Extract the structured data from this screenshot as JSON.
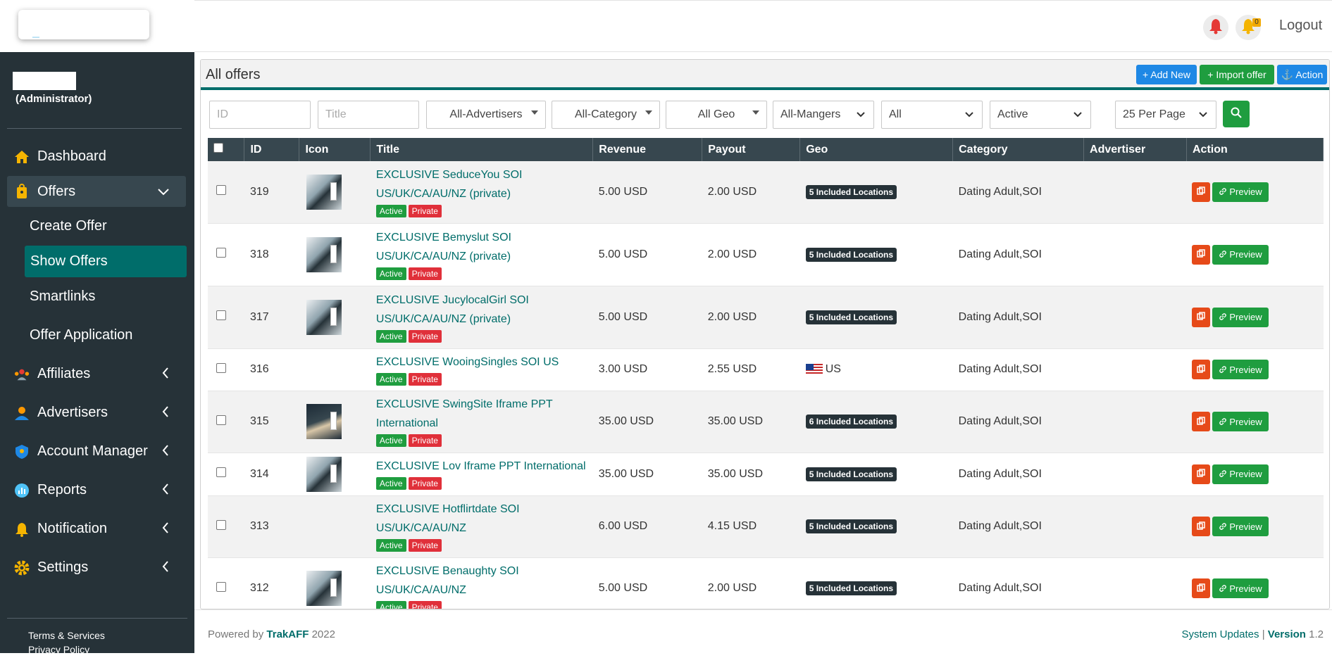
{
  "sidebar": {
    "user_role": "(Administrator)",
    "nav": {
      "dashboard": "Dashboard",
      "offers": "Offers",
      "create_offer": "Create Offer",
      "show_offers": "Show Offers",
      "smartlinks": "Smartlinks",
      "offer_application": "Offer Application",
      "affiliates": "Affiliates",
      "advertisers": "Advertisers",
      "account_manager": "Account Manager",
      "reports": "Reports",
      "notification": "Notification",
      "settings": "Settings"
    },
    "footer": {
      "terms": "Terms & Services",
      "privacy": "Privacy Policy"
    }
  },
  "topbar": {
    "notification_count": "0",
    "logout": "Logout"
  },
  "panel": {
    "title": "All offers",
    "add_new": "+ Add New",
    "import_offer": "+ Import offer",
    "action": "⚓ Action"
  },
  "filters": {
    "id_placeholder": "ID",
    "title_placeholder": "Title",
    "advertisers": "All-Advertisers",
    "category": "All-Category",
    "geo": "All Geo",
    "managers": "All-Mangers",
    "type": "All",
    "status": "Active",
    "per_page": "25 Per Page"
  },
  "table": {
    "headers": [
      "ID",
      "Icon",
      "Title",
      "Revenue",
      "Payout",
      "Geo",
      "Category",
      "Advertiser",
      "Action"
    ],
    "rows": [
      {
        "id": "319",
        "title_line1": "EXCLUSIVE SeduceYou SOI",
        "title_line2": "US/UK/CA/AU/NZ (private)",
        "status": "Active",
        "visibility": "Private",
        "revenue": "5.00 USD",
        "payout": "2.00 USD",
        "geo": "5 Included Locations",
        "category": "Dating Adult,SOI",
        "advertiser": "",
        "preview": "Preview"
      },
      {
        "id": "318",
        "title_line1": "EXCLUSIVE Bemyslut SOI",
        "title_line2": "US/UK/CA/AU/NZ (private)",
        "status": "Active",
        "visibility": "Private",
        "revenue": "5.00 USD",
        "payout": "2.00 USD",
        "geo": "5 Included Locations",
        "category": "Dating Adult,SOI",
        "advertiser": "",
        "preview": "Preview"
      },
      {
        "id": "317",
        "title_line1": "EXCLUSIVE JucylocalGirl SOI",
        "title_line2": "US/UK/CA/AU/NZ (private)",
        "status": "Active",
        "visibility": "Private",
        "revenue": "5.00 USD",
        "payout": "2.00 USD",
        "geo": "5 Included Locations",
        "category": "Dating Adult,SOI",
        "advertiser": "",
        "preview": "Preview"
      },
      {
        "id": "316",
        "title_line1": "EXCLUSIVE WooingSingles SOI US",
        "title_line2": "",
        "status": "Active",
        "visibility": "Private",
        "revenue": "3.00 USD",
        "payout": "2.55 USD",
        "geo": "US",
        "category": "Dating Adult,SOI",
        "advertiser": "",
        "preview": "Preview"
      },
      {
        "id": "315",
        "title_line1": "EXCLUSIVE SwingSite Iframe PPT",
        "title_line2": "International",
        "status": "Active",
        "visibility": "Private",
        "revenue": "35.00 USD",
        "payout": "35.00 USD",
        "geo": "6 Included Locations",
        "category": "Dating Adult,SOI",
        "advertiser": "",
        "preview": "Preview"
      },
      {
        "id": "314",
        "title_line1": "EXCLUSIVE Lov Iframe PPT International",
        "title_line2": "",
        "status": "Active",
        "visibility": "Private",
        "revenue": "35.00 USD",
        "payout": "35.00 USD",
        "geo": "5 Included Locations",
        "category": "Dating Adult,SOI",
        "advertiser": "",
        "preview": "Preview"
      },
      {
        "id": "313",
        "title_line1": "EXCLUSIVE Hotflirtdate SOI",
        "title_line2": "US/UK/CA/AU/NZ",
        "status": "Active",
        "visibility": "Private",
        "revenue": "6.00 USD",
        "payout": "4.15 USD",
        "geo": "5 Included Locations",
        "category": "Dating Adult,SOI",
        "advertiser": "",
        "preview": "Preview"
      },
      {
        "id": "312",
        "title_line1": "EXCLUSIVE Benaughty SOI",
        "title_line2": "US/UK/CA/AU/NZ",
        "status": "Active",
        "visibility": "Private",
        "revenue": "5.00 USD",
        "payout": "2.00 USD",
        "geo": "5 Included Locations",
        "category": "Dating Adult,SOI",
        "advertiser": "",
        "preview": "Preview"
      }
    ]
  },
  "footer": {
    "powered_by": "Powered by",
    "brand": "TrakAFF",
    "year": "2022",
    "system_updates": "System Updates",
    "separator": "|",
    "version_label": "Version",
    "version": "1.2"
  }
}
